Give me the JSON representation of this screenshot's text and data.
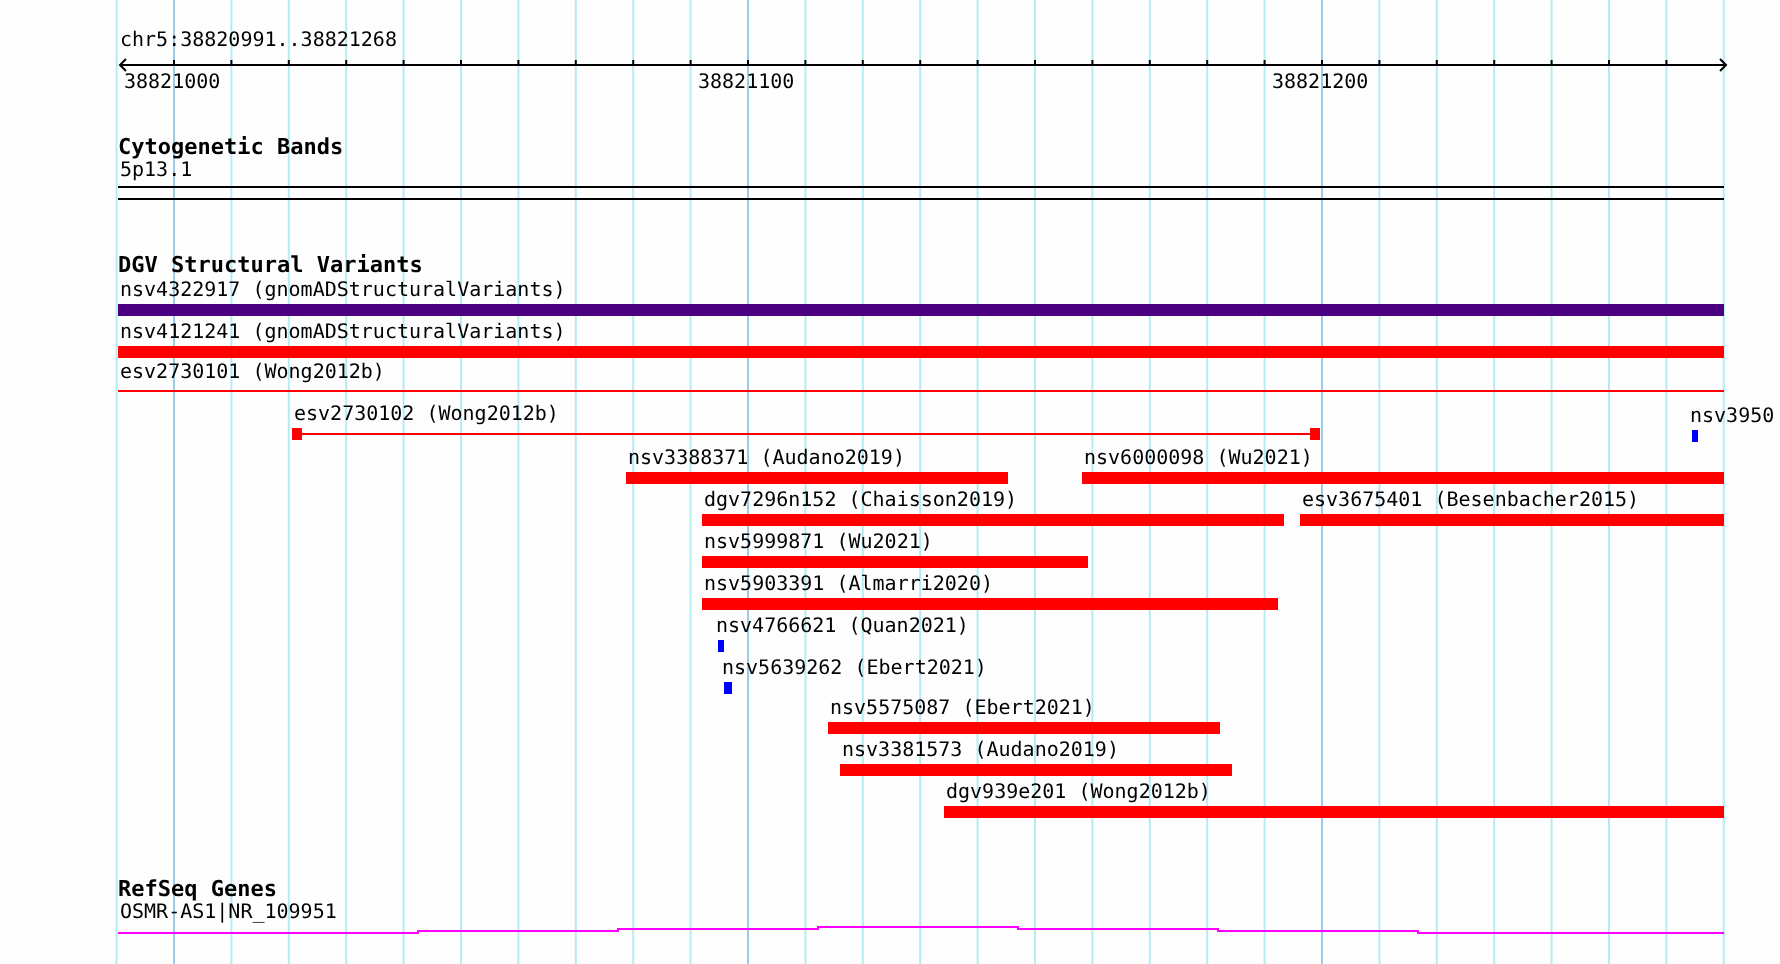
{
  "ruler": {
    "region": "chr5:38820991..38821268",
    "ticks": [
      "38821000",
      "38821100",
      "38821200"
    ]
  },
  "tracks": [
    {
      "kind": "cytoband",
      "title": "Cytogenetic Bands",
      "features": [
        {
          "label": "5p13.1"
        }
      ]
    },
    {
      "kind": "variants",
      "title": "DGV Structural Variants",
      "features": [
        {
          "label": "nsv4322917 (gnomADStructuralVariants)",
          "kind": "bar",
          "color": "#4b0082"
        },
        {
          "label": "nsv4121241 (gnomADStructuralVariants)",
          "kind": "bar",
          "color": "#ff0000"
        },
        {
          "label": "esv2730101 (Wong2012b)",
          "kind": "line",
          "color": "#ff0000"
        },
        {
          "label": "esv2730102 (Wong2012b)",
          "kind": "line-ends",
          "color": "#ff0000"
        },
        {
          "label": "nsv3950",
          "kind": "bar",
          "color": "#0000ff"
        },
        {
          "label": "nsv3388371 (Audano2019)",
          "kind": "bar",
          "color": "#ff0000"
        },
        {
          "label": "nsv6000098 (Wu2021)",
          "kind": "bar",
          "color": "#ff0000"
        },
        {
          "label": "dgv7296n152 (Chaisson2019)",
          "kind": "bar",
          "color": "#ff0000"
        },
        {
          "label": "esv3675401 (Besenbacher2015)",
          "kind": "bar",
          "color": "#ff0000"
        },
        {
          "label": "nsv5999871 (Wu2021)",
          "kind": "bar",
          "color": "#ff0000"
        },
        {
          "label": "nsv5903391 (Almarri2020)",
          "kind": "bar",
          "color": "#ff0000"
        },
        {
          "label": "nsv4766621 (Quan2021)",
          "kind": "bar",
          "color": "#0000ff"
        },
        {
          "label": "nsv5639262 (Ebert2021)",
          "kind": "bar",
          "color": "#0000ff"
        },
        {
          "label": "nsv5575087 (Ebert2021)",
          "kind": "bar",
          "color": "#ff0000"
        },
        {
          "label": "nsv3381573 (Audano2019)",
          "kind": "bar",
          "color": "#ff0000"
        },
        {
          "label": "dgv939e201 (Wong2012b)",
          "kind": "bar",
          "color": "#ff0000"
        }
      ]
    },
    {
      "kind": "gene",
      "title": "RefSeq Genes",
      "features": [
        {
          "label": "OSMR-AS1|NR_109951",
          "color": "#ff00ff"
        }
      ]
    }
  ]
}
